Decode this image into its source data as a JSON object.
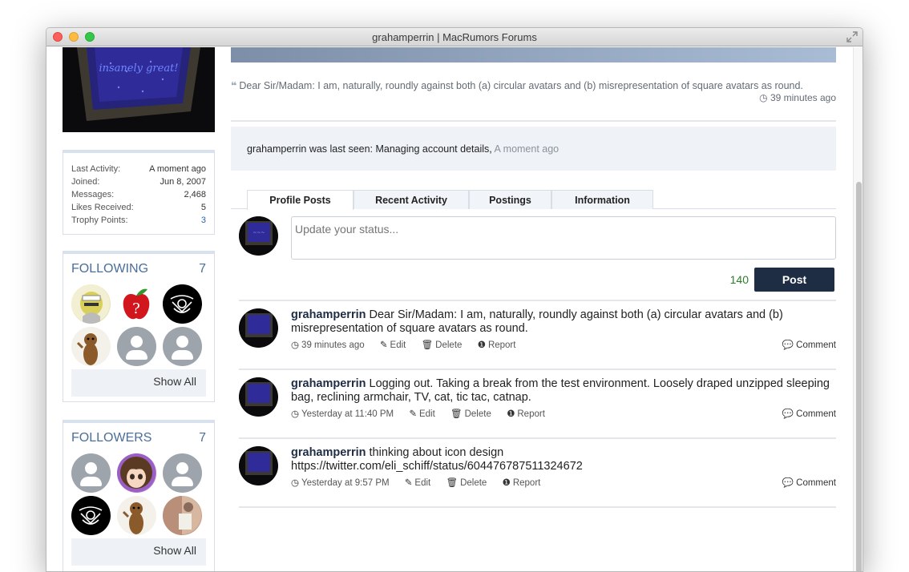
{
  "window": {
    "title": "grahamperrin | MacRumors Forums"
  },
  "sidebar": {
    "avatar_text": "insanely great!",
    "stats": [
      {
        "label": "Last Activity:",
        "value": "A moment ago",
        "link": false
      },
      {
        "label": "Joined:",
        "value": "Jun 8, 2007",
        "link": false
      },
      {
        "label": "Messages:",
        "value": "2,468",
        "link": false
      },
      {
        "label": "Likes Received:",
        "value": "5",
        "link": false
      },
      {
        "label": "Trophy Points:",
        "value": "3",
        "link": true
      }
    ],
    "following": {
      "title": "FOLLOWING",
      "count": "7",
      "show_all": "Show All"
    },
    "followers": {
      "title": "FOLLOWERS",
      "count": "7",
      "show_all": "Show All"
    }
  },
  "main": {
    "quote": {
      "text": "Dear Sir/Madam: I am, naturally, roundly against both (a) circular avatars and (b) misrepresentation of square avatars as round.",
      "time": "39 minutes ago"
    },
    "last_seen": {
      "text": "grahamperrin was last seen: Managing account details,",
      "time": "A moment ago"
    },
    "tabs": [
      "Profile Posts",
      "Recent Activity",
      "Postings",
      "Information"
    ],
    "status": {
      "placeholder": "Update your status...",
      "counter": "140",
      "post_label": "Post"
    },
    "actions": {
      "edit": "Edit",
      "delete": "Delete",
      "report": "Report",
      "comment": "Comment"
    },
    "entries": [
      {
        "author": "grahamperrin",
        "text": "Dear Sir/Madam: I am, naturally, roundly against both (a) circular avatars and (b) misrepresentation of square avatars as round.",
        "time": "39 minutes ago"
      },
      {
        "author": "grahamperrin",
        "text": "Logging out. Taking a break from the test environment. Loosely draped unzipped sleeping bag, reclining armchair, TV, cat, tic tac, catnap.",
        "time": "Yesterday at 11:40 PM"
      },
      {
        "author": "grahamperrin",
        "text": "thinking about icon design https://twitter.com/eli_schiff/status/604476787511324672",
        "time": "Yesterday at 9:57 PM"
      }
    ]
  }
}
